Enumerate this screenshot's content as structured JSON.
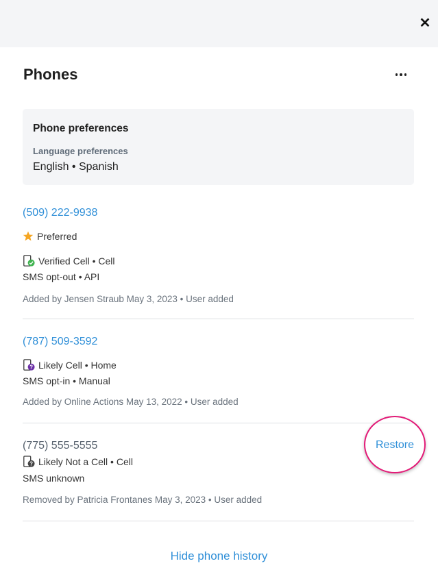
{
  "header": {
    "close_glyph": "✕"
  },
  "panel": {
    "title": "Phones"
  },
  "preferences": {
    "title": "Phone preferences",
    "language_label": "Language preferences",
    "language_value": "English • Spanish"
  },
  "phones": [
    {
      "number": "(509) 222-9938",
      "preferred": "Preferred",
      "type": "Verified Cell • Cell",
      "sms": "SMS opt-out • API",
      "added": "Added by Jensen Straub May 3, 2023 • User added",
      "status_icon": "verified-cell-icon"
    },
    {
      "number": "(787) 509-3592",
      "type": "Likely Cell • Home",
      "sms": "SMS opt-in • Manual",
      "added": "Added by Online Actions May 13, 2022 • User added",
      "status_icon": "likely-cell-icon"
    },
    {
      "number": "(775) 555-5555",
      "type": "Likely Not a Cell • Cell",
      "sms": "SMS unknown",
      "added": "Removed by Patricia Frontanes May 3, 2023 • User added",
      "status_icon": "likely-not-cell-icon",
      "action": "Restore"
    }
  ],
  "footer": {
    "hide_history": "Hide phone history"
  },
  "colors": {
    "link": "#2f8fd8",
    "highlight": "#e21a77",
    "star": "#f5a623",
    "verified": "#3fb34f",
    "likely": "#6b2fa6",
    "unknown": "#444444"
  }
}
